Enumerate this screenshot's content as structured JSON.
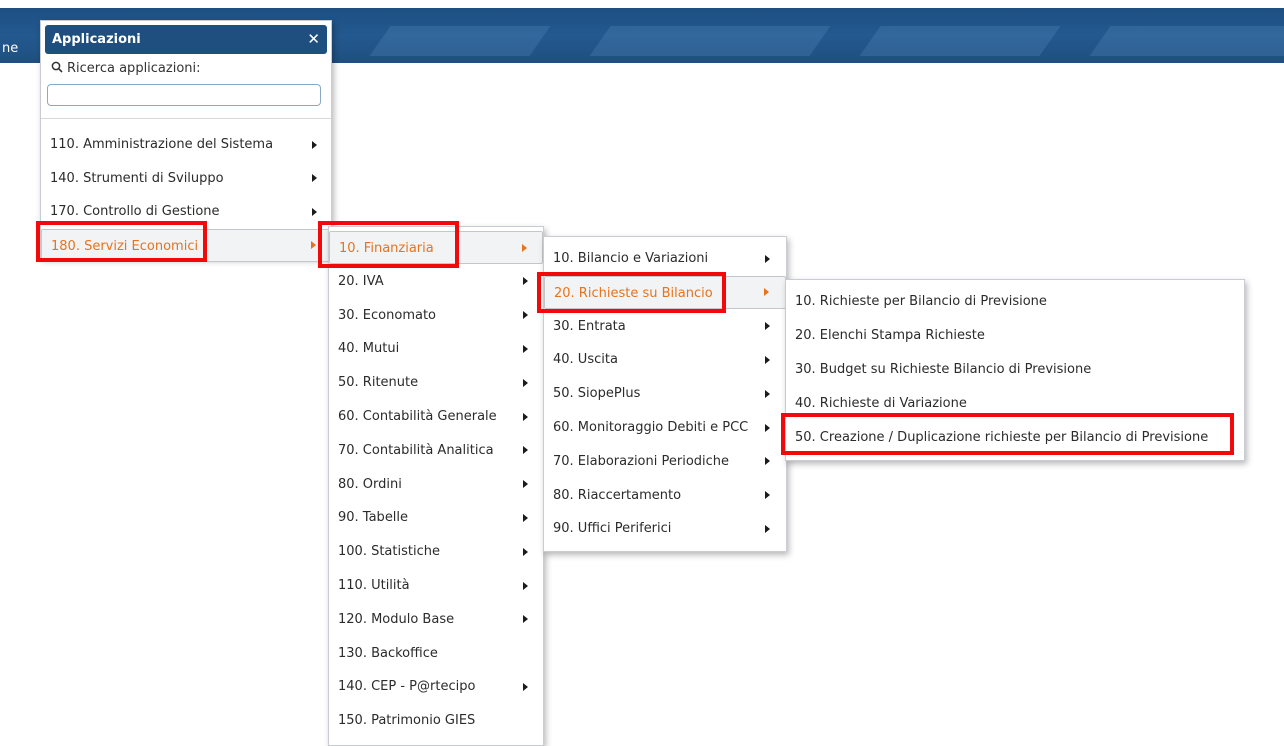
{
  "topbar": {
    "left_text": "ne"
  },
  "app_menu": {
    "title": "Applicazioni",
    "close_glyph": "✕",
    "search_icon": "🔍",
    "search_label": "Ricerca applicazioni:",
    "search_value": "",
    "items": [
      {
        "label": "110. Amministrazione del Sistema",
        "has_sub": true
      },
      {
        "label": "140. Strumenti di Sviluppo",
        "has_sub": true
      },
      {
        "label": "170. Controllo di Gestione",
        "has_sub": true
      },
      {
        "label": "180. Servizi Economici",
        "has_sub": true,
        "active": true
      }
    ]
  },
  "submenu_servizi": {
    "items": [
      {
        "label": "10. Finanziaria",
        "has_sub": true,
        "active": true
      },
      {
        "label": "20. IVA",
        "has_sub": true
      },
      {
        "label": "30. Economato",
        "has_sub": true
      },
      {
        "label": "40. Mutui",
        "has_sub": true
      },
      {
        "label": "50. Ritenute",
        "has_sub": true
      },
      {
        "label": "60. Contabilità Generale",
        "has_sub": true
      },
      {
        "label": "70. Contabilità Analitica",
        "has_sub": true
      },
      {
        "label": "80. Ordini",
        "has_sub": true
      },
      {
        "label": "90. Tabelle",
        "has_sub": true
      },
      {
        "label": "100. Statistiche",
        "has_sub": true
      },
      {
        "label": "110. Utilità",
        "has_sub": true
      },
      {
        "label": "120. Modulo Base",
        "has_sub": true
      },
      {
        "label": "130. Backoffice",
        "has_sub": false
      },
      {
        "label": "140. CEP - P@rtecipo",
        "has_sub": true
      },
      {
        "label": "150. Patrimonio GIES",
        "has_sub": false
      }
    ]
  },
  "submenu_finanziaria": {
    "items": [
      {
        "label": "10. Bilancio e Variazioni",
        "has_sub": true
      },
      {
        "label": "20. Richieste su Bilancio",
        "has_sub": true,
        "active": true
      },
      {
        "label": "30. Entrata",
        "has_sub": true
      },
      {
        "label": "40. Uscita",
        "has_sub": true
      },
      {
        "label": "50. SiopePlus",
        "has_sub": true
      },
      {
        "label": "60. Monitoraggio Debiti e PCC",
        "has_sub": true
      },
      {
        "label": "70. Elaborazioni Periodiche",
        "has_sub": true
      },
      {
        "label": "80. Riaccertamento",
        "has_sub": true
      },
      {
        "label": "90. Uffici Periferici",
        "has_sub": true
      }
    ]
  },
  "submenu_richieste": {
    "items": [
      {
        "label": "10. Richieste per Bilancio di Previsione",
        "has_sub": false
      },
      {
        "label": "20. Elenchi Stampa Richieste",
        "has_sub": false
      },
      {
        "label": "30. Budget su Richieste Bilancio di Previsione",
        "has_sub": false
      },
      {
        "label": "40. Richieste di Variazione",
        "has_sub": false
      },
      {
        "label": "50. Creazione / Duplicazione richieste per Bilancio di Previsione",
        "has_sub": false
      }
    ]
  },
  "colors": {
    "header_blue": "#1f4f7f",
    "active_text": "#e8731c",
    "highlight_red": "#f00a0a"
  }
}
